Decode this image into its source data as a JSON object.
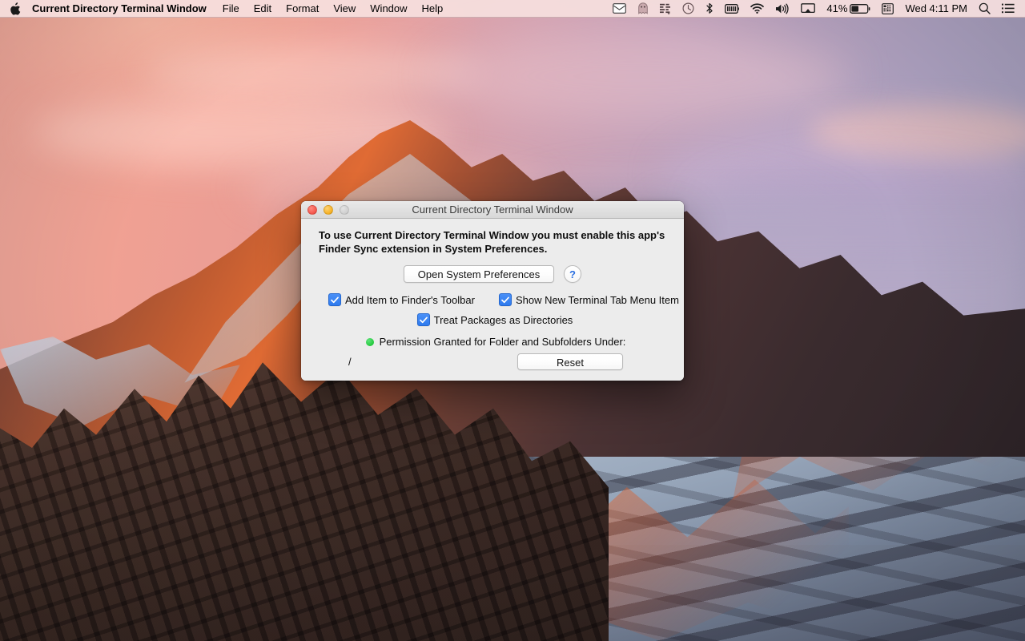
{
  "menubar": {
    "apple_icon": "apple-logo-icon",
    "app_title": "Current Directory Terminal Window",
    "menus": [
      {
        "label": "File"
      },
      {
        "label": "Edit"
      },
      {
        "label": "Format"
      },
      {
        "label": "View"
      },
      {
        "label": "Window"
      },
      {
        "label": "Help"
      }
    ],
    "status_icons": [
      {
        "name": "mail-envelope-icon"
      },
      {
        "name": "ghost-icon"
      },
      {
        "name": "text-lines-icon"
      },
      {
        "name": "clock-history-icon"
      },
      {
        "name": "bluetooth-icon"
      },
      {
        "name": "keyboard-battery-icon"
      },
      {
        "name": "wifi-icon"
      },
      {
        "name": "volume-icon"
      },
      {
        "name": "airplay-icon"
      }
    ],
    "battery_percent": "41%",
    "trailing_icons": [
      {
        "name": "script-menu-icon"
      }
    ],
    "clock": "Wed 4:11 PM",
    "search_icon": "search-icon",
    "notification_icon": "notification-center-icon"
  },
  "window": {
    "title": "Current Directory Terminal Window",
    "traffic_lights": {
      "close": "close-button",
      "minimize": "minimize-button",
      "zoom": "zoom-button"
    },
    "notice": "To use Current Directory Terminal Window you must enable this app's Finder Sync extension in System Preferences.",
    "open_prefs_label": "Open System Preferences",
    "help_label": "?",
    "checkboxes": [
      {
        "label": "Add Item to Finder's Toolbar",
        "checked": true
      },
      {
        "label": "Show New Terminal Tab Menu Item",
        "checked": true
      },
      {
        "label": "Treat Packages as Directories",
        "checked": true
      }
    ],
    "permission_label": "Permission Granted for Folder and Subfolders Under:",
    "permission_status_color": "#28cd41",
    "path": "/",
    "reset_label": "Reset"
  },
  "colors": {
    "accent_blue": "#2f7bee",
    "status_green": "#28cd41",
    "window_bg": "#ececec",
    "menubar_bg": "#f6e0de"
  }
}
